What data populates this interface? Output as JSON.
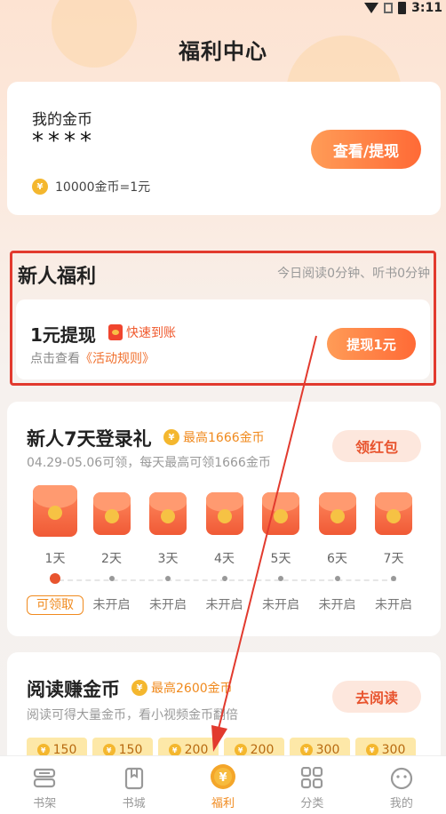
{
  "status_bar": {
    "time": "3:11"
  },
  "page": {
    "title": "福利中心"
  },
  "coins_card": {
    "label": "我的金币",
    "value": "****",
    "rate": "10000金币=1元",
    "view_button": "查看/提现"
  },
  "newbie": {
    "title": "新人福利",
    "subtitle": "今日阅读0分钟、听书0分钟",
    "withdraw_title": "1元提现",
    "fast_tag": "快速到账",
    "rules_prefix": "点击查看",
    "rules_link": "《活动规则》",
    "withdraw_button": "提现1元"
  },
  "login_gift": {
    "title": "新人7天登录礼",
    "max": "最高1666金币",
    "subtitle": "04.29-05.06可领，每天最高可领1666金币",
    "button": "领红包",
    "days": [
      {
        "label": "1天",
        "status": "可领取",
        "active": true
      },
      {
        "label": "2天",
        "status": "未开启",
        "active": false
      },
      {
        "label": "3天",
        "status": "未开启",
        "active": false
      },
      {
        "label": "4天",
        "status": "未开启",
        "active": false
      },
      {
        "label": "5天",
        "status": "未开启",
        "active": false
      },
      {
        "label": "6天",
        "status": "未开启",
        "active": false
      },
      {
        "label": "7天",
        "status": "未开启",
        "active": false
      }
    ]
  },
  "read_earn": {
    "title": "阅读赚金币",
    "max": "最高2600金币",
    "subtitle": "阅读可得大量金币，看小视频金币翻倍",
    "button": "去阅读",
    "chips": [
      "150",
      "150",
      "200",
      "200",
      "300",
      "300"
    ]
  },
  "tabbar": [
    {
      "label": "书架",
      "icon": "bookshelf-icon",
      "active": false
    },
    {
      "label": "书城",
      "icon": "bookstore-icon",
      "active": false
    },
    {
      "label": "福利",
      "icon": "yen-coin-icon",
      "active": true
    },
    {
      "label": "分类",
      "icon": "grid-icon",
      "active": false
    },
    {
      "label": "我的",
      "icon": "smiley-icon",
      "active": false
    }
  ],
  "colors": {
    "accent": "#ff6a36",
    "highlight_box": "#e23a2e",
    "coin": "#f4b72e",
    "active_tab": "#f08a1e"
  }
}
